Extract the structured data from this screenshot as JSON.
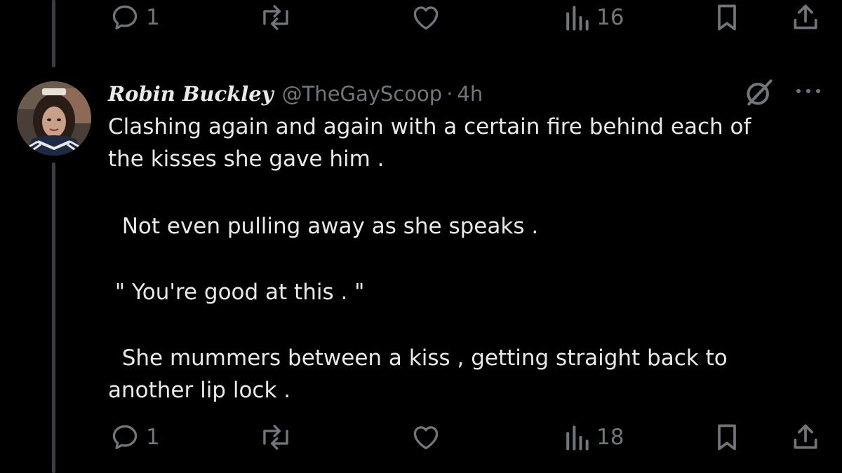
{
  "top_actions": {
    "replies": "1",
    "views": "16"
  },
  "tweet": {
    "author_name": "Robin Buckley",
    "handle": "@TheGayScoop",
    "separator": "·",
    "time": "4h",
    "lines": [
      "Clashing again and again with a certain fire behind each of",
      "the kisses she gave him .",
      "  Not even pulling away as she speaks .",
      " \" You're good at this . \"",
      "  She mummers between a kiss , getting straight back to",
      "another lip lock ."
    ]
  },
  "bottom_actions": {
    "replies": "1",
    "views": "18"
  },
  "icons": [
    "reply-icon",
    "repost-icon",
    "like-icon",
    "views-icon",
    "bookmark-icon",
    "share-icon",
    "grok-icon",
    "more-icon"
  ],
  "colors": {
    "background": "#000000",
    "text": "#e7e9ea",
    "muted": "#71767b",
    "thread_line": "#3a3d41"
  }
}
